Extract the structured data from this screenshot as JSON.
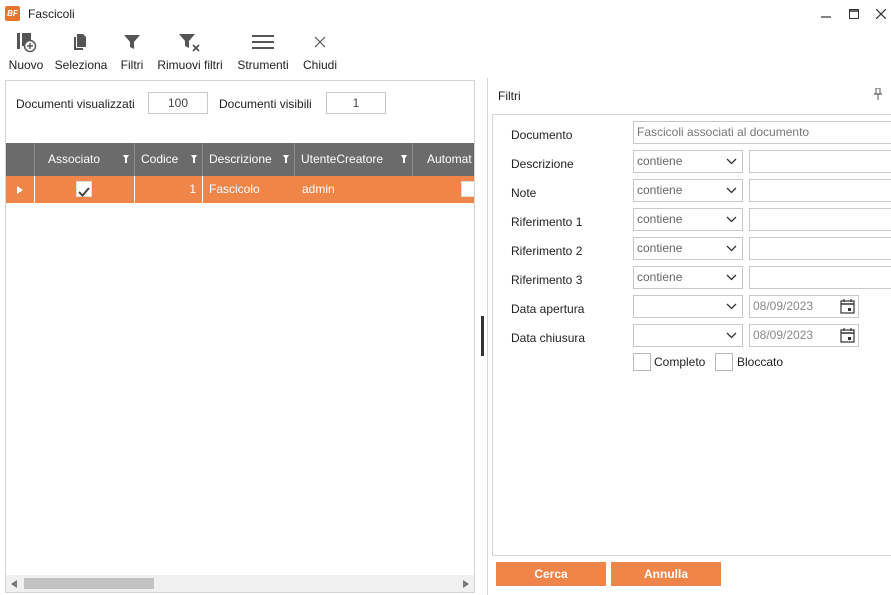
{
  "window": {
    "logo_text": "BF",
    "title": "Fascicoli"
  },
  "toolbar": {
    "nuovo": "Nuovo",
    "seleziona": "Seleziona",
    "filtri": "Filtri",
    "rimuovi_filtri": "Rimuovi filtri",
    "strumenti": "Strumenti",
    "chiudi": "Chiudi"
  },
  "info": {
    "visualizzati_label": "Documenti visualizzati",
    "visualizzati_value": "100",
    "visibili_label": "Documenti visibili",
    "visibili_value": "1"
  },
  "grid": {
    "columns": [
      "Associato",
      "Codice",
      "Descrizione",
      "UtenteCreatore",
      "Automat"
    ],
    "rows": [
      {
        "associato": true,
        "codice": "1",
        "descrizione": "Fascicolo",
        "utente": "admin",
        "automatico": false
      }
    ]
  },
  "filters": {
    "title": "Filtri",
    "documento_label": "Documento",
    "documento_value": "Fascicoli associati al documento",
    "descrizione_label": "Descrizione",
    "descrizione_op": "contiene",
    "note_label": "Note",
    "note_op": "contiene",
    "rif1_label": "Riferimento 1",
    "rif1_op": "contiene",
    "rif2_label": "Riferimento 2",
    "rif2_op": "contiene",
    "rif3_label": "Riferimento 3",
    "rif3_op": "contiene",
    "apertura_label": "Data apertura",
    "apertura_date": "08/09/2023",
    "chiusura_label": "Data chiusura",
    "chiusura_date": "08/09/2023",
    "completo_label": "Completo",
    "bloccato_label": "Bloccato"
  },
  "actions": {
    "cerca": "Cerca",
    "annulla": "Annulla"
  },
  "colors": {
    "accent": "#f0854a",
    "grid_header": "#6b6b6b"
  }
}
